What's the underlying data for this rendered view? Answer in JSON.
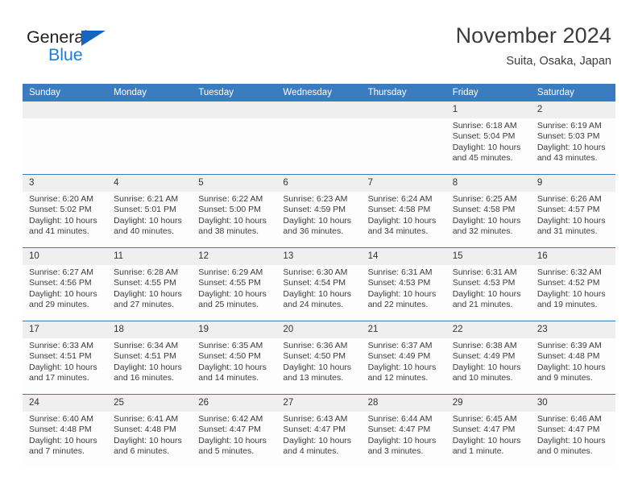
{
  "brand": {
    "name_part1": "General",
    "name_part2": "Blue",
    "triangle_color": "#1565c0",
    "blue_color": "#1e7fd4"
  },
  "header": {
    "title": "November 2024",
    "subtitle": "Suita, Osaka, Japan"
  },
  "theme": {
    "header_bar": "#3b7cc0",
    "daynum_bg": "#efefef",
    "cell_bg": "#fdfdfd",
    "text": "#3b3b3b"
  },
  "columns": [
    "Sunday",
    "Monday",
    "Tuesday",
    "Wednesday",
    "Thursday",
    "Friday",
    "Saturday"
  ],
  "weeks": [
    [
      {
        "day": "",
        "lines": [
          "",
          "",
          "",
          ""
        ]
      },
      {
        "day": "",
        "lines": [
          "",
          "",
          "",
          ""
        ]
      },
      {
        "day": "",
        "lines": [
          "",
          "",
          "",
          ""
        ]
      },
      {
        "day": "",
        "lines": [
          "",
          "",
          "",
          ""
        ]
      },
      {
        "day": "",
        "lines": [
          "",
          "",
          "",
          ""
        ]
      },
      {
        "day": "1",
        "lines": [
          "Sunrise: 6:18 AM",
          "Sunset: 5:04 PM",
          "Daylight: 10 hours",
          "and 45 minutes."
        ]
      },
      {
        "day": "2",
        "lines": [
          "Sunrise: 6:19 AM",
          "Sunset: 5:03 PM",
          "Daylight: 10 hours",
          "and 43 minutes."
        ]
      }
    ],
    [
      {
        "day": "3",
        "lines": [
          "Sunrise: 6:20 AM",
          "Sunset: 5:02 PM",
          "Daylight: 10 hours",
          "and 41 minutes."
        ]
      },
      {
        "day": "4",
        "lines": [
          "Sunrise: 6:21 AM",
          "Sunset: 5:01 PM",
          "Daylight: 10 hours",
          "and 40 minutes."
        ]
      },
      {
        "day": "5",
        "lines": [
          "Sunrise: 6:22 AM",
          "Sunset: 5:00 PM",
          "Daylight: 10 hours",
          "and 38 minutes."
        ]
      },
      {
        "day": "6",
        "lines": [
          "Sunrise: 6:23 AM",
          "Sunset: 4:59 PM",
          "Daylight: 10 hours",
          "and 36 minutes."
        ]
      },
      {
        "day": "7",
        "lines": [
          "Sunrise: 6:24 AM",
          "Sunset: 4:58 PM",
          "Daylight: 10 hours",
          "and 34 minutes."
        ]
      },
      {
        "day": "8",
        "lines": [
          "Sunrise: 6:25 AM",
          "Sunset: 4:58 PM",
          "Daylight: 10 hours",
          "and 32 minutes."
        ]
      },
      {
        "day": "9",
        "lines": [
          "Sunrise: 6:26 AM",
          "Sunset: 4:57 PM",
          "Daylight: 10 hours",
          "and 31 minutes."
        ]
      }
    ],
    [
      {
        "day": "10",
        "lines": [
          "Sunrise: 6:27 AM",
          "Sunset: 4:56 PM",
          "Daylight: 10 hours",
          "and 29 minutes."
        ]
      },
      {
        "day": "11",
        "lines": [
          "Sunrise: 6:28 AM",
          "Sunset: 4:55 PM",
          "Daylight: 10 hours",
          "and 27 minutes."
        ]
      },
      {
        "day": "12",
        "lines": [
          "Sunrise: 6:29 AM",
          "Sunset: 4:55 PM",
          "Daylight: 10 hours",
          "and 25 minutes."
        ]
      },
      {
        "day": "13",
        "lines": [
          "Sunrise: 6:30 AM",
          "Sunset: 4:54 PM",
          "Daylight: 10 hours",
          "and 24 minutes."
        ]
      },
      {
        "day": "14",
        "lines": [
          "Sunrise: 6:31 AM",
          "Sunset: 4:53 PM",
          "Daylight: 10 hours",
          "and 22 minutes."
        ]
      },
      {
        "day": "15",
        "lines": [
          "Sunrise: 6:31 AM",
          "Sunset: 4:53 PM",
          "Daylight: 10 hours",
          "and 21 minutes."
        ]
      },
      {
        "day": "16",
        "lines": [
          "Sunrise: 6:32 AM",
          "Sunset: 4:52 PM",
          "Daylight: 10 hours",
          "and 19 minutes."
        ]
      }
    ],
    [
      {
        "day": "17",
        "lines": [
          "Sunrise: 6:33 AM",
          "Sunset: 4:51 PM",
          "Daylight: 10 hours",
          "and 17 minutes."
        ]
      },
      {
        "day": "18",
        "lines": [
          "Sunrise: 6:34 AM",
          "Sunset: 4:51 PM",
          "Daylight: 10 hours",
          "and 16 minutes."
        ]
      },
      {
        "day": "19",
        "lines": [
          "Sunrise: 6:35 AM",
          "Sunset: 4:50 PM",
          "Daylight: 10 hours",
          "and 14 minutes."
        ]
      },
      {
        "day": "20",
        "lines": [
          "Sunrise: 6:36 AM",
          "Sunset: 4:50 PM",
          "Daylight: 10 hours",
          "and 13 minutes."
        ]
      },
      {
        "day": "21",
        "lines": [
          "Sunrise: 6:37 AM",
          "Sunset: 4:49 PM",
          "Daylight: 10 hours",
          "and 12 minutes."
        ]
      },
      {
        "day": "22",
        "lines": [
          "Sunrise: 6:38 AM",
          "Sunset: 4:49 PM",
          "Daylight: 10 hours",
          "and 10 minutes."
        ]
      },
      {
        "day": "23",
        "lines": [
          "Sunrise: 6:39 AM",
          "Sunset: 4:48 PM",
          "Daylight: 10 hours",
          "and 9 minutes."
        ]
      }
    ],
    [
      {
        "day": "24",
        "lines": [
          "Sunrise: 6:40 AM",
          "Sunset: 4:48 PM",
          "Daylight: 10 hours",
          "and 7 minutes."
        ]
      },
      {
        "day": "25",
        "lines": [
          "Sunrise: 6:41 AM",
          "Sunset: 4:48 PM",
          "Daylight: 10 hours",
          "and 6 minutes."
        ]
      },
      {
        "day": "26",
        "lines": [
          "Sunrise: 6:42 AM",
          "Sunset: 4:47 PM",
          "Daylight: 10 hours",
          "and 5 minutes."
        ]
      },
      {
        "day": "27",
        "lines": [
          "Sunrise: 6:43 AM",
          "Sunset: 4:47 PM",
          "Daylight: 10 hours",
          "and 4 minutes."
        ]
      },
      {
        "day": "28",
        "lines": [
          "Sunrise: 6:44 AM",
          "Sunset: 4:47 PM",
          "Daylight: 10 hours",
          "and 3 minutes."
        ]
      },
      {
        "day": "29",
        "lines": [
          "Sunrise: 6:45 AM",
          "Sunset: 4:47 PM",
          "Daylight: 10 hours",
          "and 1 minute."
        ]
      },
      {
        "day": "30",
        "lines": [
          "Sunrise: 6:46 AM",
          "Sunset: 4:47 PM",
          "Daylight: 10 hours",
          "and 0 minutes."
        ]
      }
    ]
  ]
}
